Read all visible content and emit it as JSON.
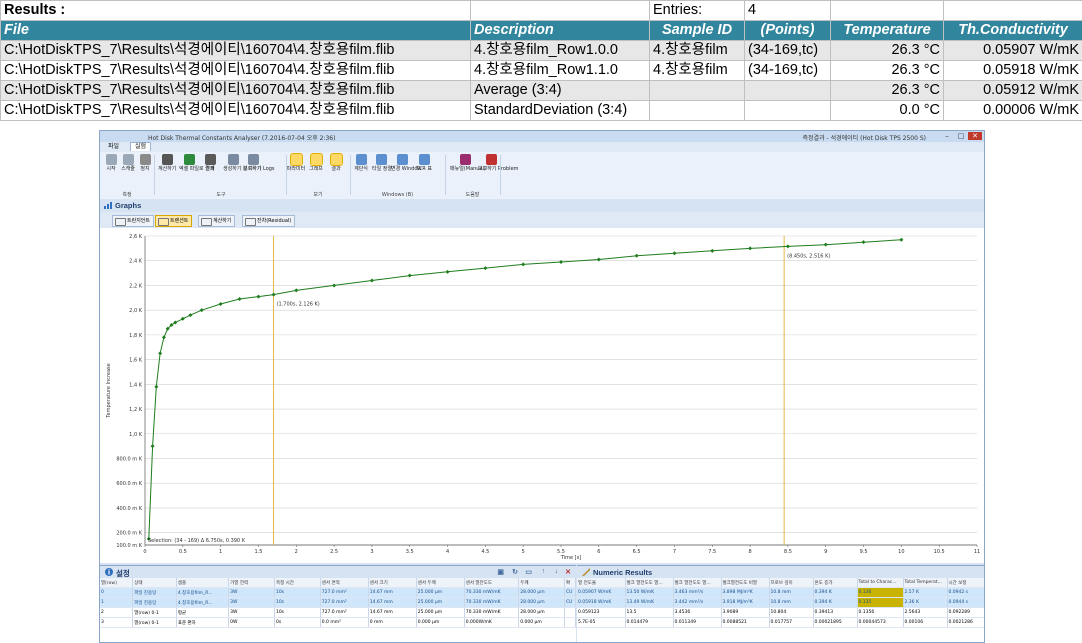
{
  "sheet": {
    "title": "Results :",
    "entries_label": "Entries:",
    "entries_value": "4",
    "headers": [
      "File",
      "Description",
      "Sample ID",
      "(Points)",
      "Temperature",
      "Th.Conductivity"
    ],
    "rows": [
      {
        "file": "C:\\HotDiskTPS_7\\Results\\석경에이티\\160704\\4.창호용film.flib",
        "description": "4.창호용film_Row1.0.0",
        "sample_id": "4.창호용film",
        "points": "(34-169,tc)",
        "temperature": "26.3 °C",
        "conductivity": "0.05907 W/mK"
      },
      {
        "file": "C:\\HotDiskTPS_7\\Results\\석경에이티\\160704\\4.창호용film.flib",
        "description": "4.창호용film_Row1.1.0",
        "sample_id": "4.창호용film",
        "points": "(34-169,tc)",
        "temperature": "26.3 °C",
        "conductivity": "0.05918 W/mK"
      },
      {
        "file": "C:\\HotDiskTPS_7\\Results\\석경에이티\\160704\\4.창호용film.flib",
        "description": "Average (3:4)",
        "sample_id": "",
        "points": "",
        "temperature": "26.3 °C",
        "conductivity": "0.05912 W/mK"
      },
      {
        "file": "C:\\HotDiskTPS_7\\Results\\석경에이티\\160704\\4.창호용film.flib",
        "description": "StandardDeviation (3:4)",
        "sample_id": "",
        "points": "",
        "temperature": "0.0 °C",
        "conductivity": "0.00006 W/mK"
      }
    ]
  },
  "window": {
    "title": "Hot Disk Thermal Constants Analyser (7.2016-07-04 오후 2:36)",
    "right_title": "측정결과 - 석경에이티 (Hot Disk TPS 2500 S)",
    "menu": [
      "파일",
      "실험"
    ],
    "ribbon": {
      "buttons": [
        {
          "label": "시작",
          "icon": "play-icon",
          "color": "#9aa8b8"
        },
        {
          "label": "스캐줄",
          "icon": "schedule-icon",
          "color": "#9aa8b8"
        },
        {
          "label": "정지",
          "icon": "stop-icon",
          "color": "#8a8a8a"
        },
        {
          "label": "계산하기",
          "icon": "calculator-icon",
          "color": "#555555"
        },
        {
          "label": "엑셀 파일로 결과",
          "icon": "excel-icon",
          "color": "#2e8b3e"
        },
        {
          "label": "인쇄",
          "icon": "printer-icon",
          "color": "#5a5a5a"
        },
        {
          "label": "생성하기 보고하기",
          "icon": "report-icon",
          "color": "#7a8aa0"
        },
        {
          "label": "분석하기 Logs",
          "icon": "magnifier-icon",
          "color": "#7a8aa0"
        },
        {
          "label": "파라미터",
          "icon": "info-icon",
          "color": "#2f6fc0"
        },
        {
          "label": "그래프",
          "icon": "graph-icon",
          "color": "#4d7fb8"
        },
        {
          "label": "결과",
          "icon": "ruler-icon",
          "color": "#b88a2a"
        },
        {
          "label": "계단식",
          "icon": "cascade-icon",
          "color": "#5b8fd0"
        },
        {
          "label": "타일 정렬",
          "icon": "tile-icon",
          "color": "#5b8fd0"
        },
        {
          "label": "변경 Window",
          "icon": "window-icon",
          "color": "#5b8fd0"
        },
        {
          "label": "TCR 표",
          "icon": "tcr-icon",
          "color": "#5b8fd0"
        },
        {
          "label": "매뉴얼(Manual)",
          "icon": "book-icon",
          "color": "#9b2d6e"
        },
        {
          "label": "보고하기 Problem",
          "icon": "problem-icon",
          "color": "#c03030"
        }
      ],
      "groups": [
        "측정",
        "도구",
        "보기",
        "Windows (B)",
        "도움말"
      ]
    },
    "graphs_title": "Graphs",
    "graph_tabs": [
      "트란지언트",
      "트랜션트",
      "계산하기",
      "잔차(Residual)"
    ],
    "panel_left_title": "설정",
    "panel_right_title": "Numeric Results",
    "settings_table": {
      "headers": [
        "열(row)",
        "상태",
        "샘플",
        "가열 전력",
        "측정 시간",
        "센서 면적",
        "센서 크기",
        "센서 두께",
        "센서 열전도도",
        "두께",
        "확"
      ],
      "rows": [
        [
          "0",
          "파일 진용탕",
          "4.창호용film_R...",
          "3W",
          "10s",
          "727.0 mm²",
          "14.67 mm",
          "25.000 µm",
          "70.330 mW/mK",
          "28.000 µm",
          "CU"
        ],
        [
          "1",
          "파일 진용탕",
          "4.창호용film_R...",
          "3W",
          "10s",
          "727.0 mm²",
          "14.67 mm",
          "25.000 µm",
          "70.330 mW/mK",
          "28.000 µm",
          "CU"
        ],
        [
          "2",
          "열(row) 0-1",
          "평균",
          "3W",
          "10s",
          "727.0 mm²",
          "14.67 mm",
          "25.000 µm",
          "70.330 mW/mK",
          "28.000 µm",
          ""
        ],
        [
          "3",
          "열(row) 0-1",
          "표준 편차",
          "0W",
          "0s",
          "0.0 mm²",
          "0 mm",
          "0.000 µm",
          "0.000W/mK",
          "0.000 µm",
          ""
        ]
      ]
    },
    "numeric_table": {
      "headers": [
        "열 전도율",
        "벌크 열전도도 열...",
        "벌크 열전도도 열...",
        "벌크열전도도 비열",
        "프로브 깊이",
        "온도 증가",
        "Total to Charac...",
        "Total Temperat...",
        "시간 보정"
      ],
      "rows": [
        [
          "0.05907 W/mK",
          "13.50 W/mK",
          "3.463 mm²/s",
          "3.898 MJ/m³K",
          "10.8 mm",
          "0.394 K",
          "0.136",
          "2.57 K",
          "0.0942 s"
        ],
        [
          "0.05918 W/mK",
          "13.49 W/mK",
          "3.442 mm²/s",
          "3.918 MJ/m³K",
          "10.8 mm",
          "0.394 K",
          "0.135",
          "2.36 K",
          "0.0944 s"
        ],
        [
          "0.059123",
          "13.5",
          "3.4536",
          "3.9089",
          "10.804",
          "0.39413",
          "0.1356",
          "2.5643",
          "0.092289"
        ],
        [
          "5.7E-05",
          "0.014479",
          "0.011349",
          "0.0088521",
          "0.017757",
          "0.00021895",
          "0.00044573",
          "0.00106",
          "0.0021286"
        ]
      ]
    }
  },
  "chart_data": {
    "type": "scatter",
    "title": "",
    "xlabel": "Time [s]",
    "ylabel": "Temperature Increase",
    "xlim": [
      0,
      11
    ],
    "ylim": [
      0.1,
      2.6
    ],
    "x_ticks": [
      "0",
      "0.5",
      "1",
      "1.5",
      "2",
      "2.5",
      "3",
      "3.5",
      "4",
      "4.5",
      "5",
      "5.5",
      "6",
      "6.5",
      "7",
      "7.5",
      "8",
      "8.5",
      "9",
      "9.5",
      "10",
      "10.5",
      "11"
    ],
    "y_ticks": [
      {
        "v": 0.1,
        "label": "100.0 m K"
      },
      {
        "v": 0.2,
        "label": "200.0 m K"
      },
      {
        "v": 0.4,
        "label": "400.0 m K"
      },
      {
        "v": 0.6,
        "label": "600.0 m K"
      },
      {
        "v": 0.8,
        "label": "800.0 m K"
      },
      {
        "v": 1.0,
        "label": "1,0 K"
      },
      {
        "v": 1.2,
        "label": "1,2 K"
      },
      {
        "v": 1.4,
        "label": "1,4 K"
      },
      {
        "v": 1.6,
        "label": "1,6 K"
      },
      {
        "v": 1.8,
        "label": "1,8 K"
      },
      {
        "v": 2.0,
        "label": "2,0 K"
      },
      {
        "v": 2.2,
        "label": "2,2 K"
      },
      {
        "v": 2.4,
        "label": "2,4 K"
      },
      {
        "v": 2.6,
        "label": "2,6 K"
      }
    ],
    "grid": true,
    "series_color": "#1e7d1e",
    "cursor_color": "#e0b030",
    "cursors": [
      {
        "x": 1.7,
        "label": "(1.700s, 2.126 K)",
        "y": 2.126
      },
      {
        "x": 8.45,
        "label": "(8.450s, 2.516 K)",
        "y": 2.516
      }
    ],
    "selection_text": "Selection: (34 - 169) Δ 6.750s, 0.390 K",
    "series": [
      {
        "x": [
          0.05,
          0.1,
          0.15,
          0.2,
          0.25,
          0.3,
          0.35,
          0.4,
          0.5,
          0.6,
          0.75,
          1.0,
          1.25,
          1.5,
          1.7,
          2.0,
          2.5,
          3.0,
          3.5,
          4.0,
          4.5,
          5.0,
          5.5,
          6.0,
          6.5,
          7.0,
          7.5,
          8.0,
          8.5,
          9.0,
          9.5,
          10.0
        ],
        "y": [
          0.15,
          0.9,
          1.38,
          1.65,
          1.78,
          1.85,
          1.88,
          1.9,
          1.93,
          1.96,
          2.0,
          2.05,
          2.09,
          2.11,
          2.126,
          2.16,
          2.2,
          2.24,
          2.28,
          2.31,
          2.34,
          2.37,
          2.39,
          2.41,
          2.44,
          2.46,
          2.48,
          2.5,
          2.516,
          2.53,
          2.55,
          2.57
        ]
      }
    ]
  }
}
